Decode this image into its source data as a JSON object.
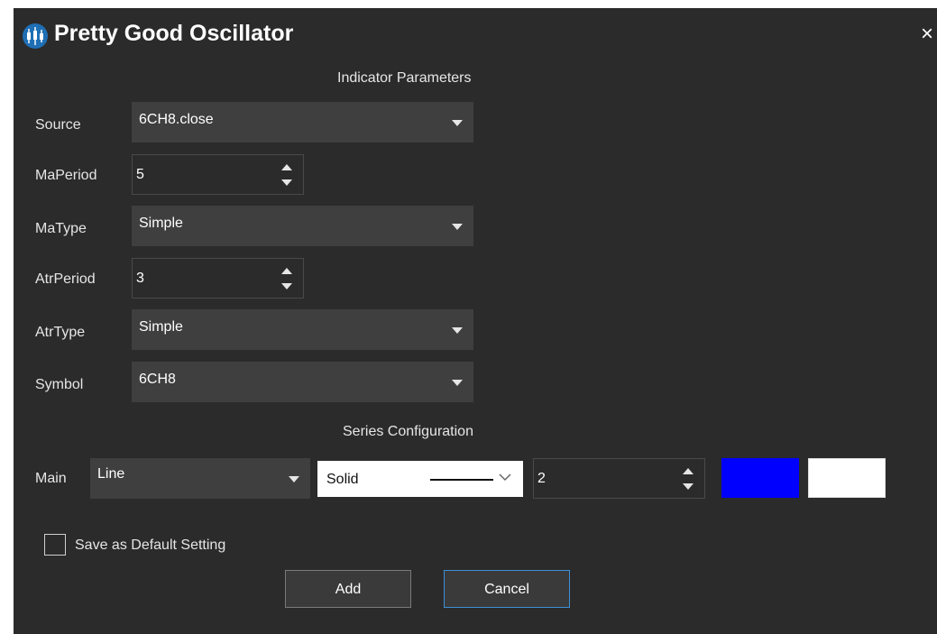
{
  "window": {
    "title": "Pretty Good Oscillator",
    "close_label": "×",
    "app_icon": "candlestick-chart-icon"
  },
  "indicator_params": {
    "heading": "Indicator Parameters",
    "source": {
      "label": "Source",
      "value": "6CH8.close"
    },
    "ma_period": {
      "label": "MaPeriod",
      "value": "5"
    },
    "ma_type": {
      "label": "MaType",
      "value": "Simple"
    },
    "atr_period": {
      "label": "AtrPeriod",
      "value": "3"
    },
    "atr_type": {
      "label": "AtrType",
      "value": "Simple"
    },
    "symbol": {
      "label": "Symbol",
      "value": "6CH8"
    }
  },
  "series_config": {
    "heading": "Series Configuration",
    "main": {
      "label": "Main",
      "type": "Line",
      "line_style": "Solid",
      "width": "2",
      "color_primary": "#0000ff",
      "color_secondary": "#ffffff"
    }
  },
  "save_default": {
    "label": "Save as Default Setting",
    "checked": false
  },
  "buttons": {
    "add": "Add",
    "cancel": "Cancel"
  }
}
